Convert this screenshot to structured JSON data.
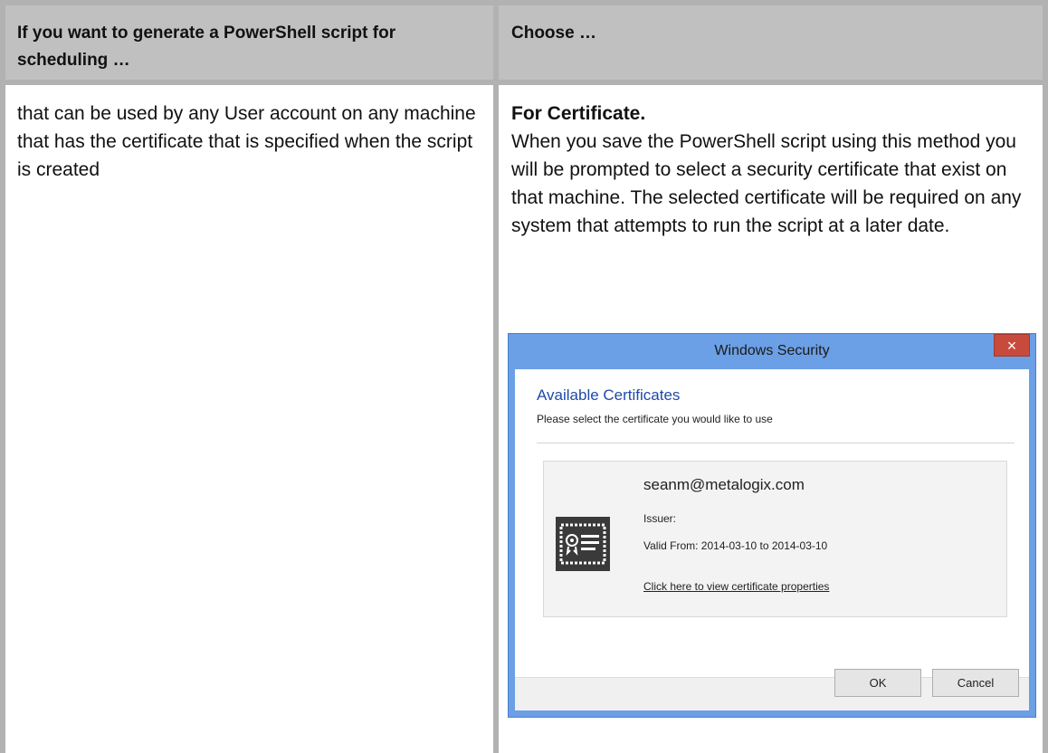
{
  "table": {
    "header": {
      "col1": "If you want to generate a PowerShell script for scheduling …",
      "col2": "Choose …"
    },
    "row": {
      "col1": "that can be used by any User account on any machine that has the certificate that is specified when the script is created",
      "col2_title": "For Certificate.",
      "col2_text": "When you save the PowerShell script using this method you will be prompted to select a security certificate that exist on that machine. The selected certificate will be required on any system that attempts to run the script at a later date."
    }
  },
  "dialog": {
    "title": "Windows Security",
    "close_glyph": "×",
    "heading": "Available Certificates",
    "subtitle": "Please select the certificate you would like to use",
    "certificate": {
      "subject": "seanm@metalogix.com",
      "issuer": "Issuer:",
      "valid": "Valid From: 2014-03-10 to 2014-03-10",
      "link": "Click here to view certificate properties"
    },
    "ok_label": "OK",
    "cancel_label": "Cancel"
  },
  "colors": {
    "header_bg": "#c0c0c0",
    "border": "#b2b2b2",
    "dialog_frame": "#6b9fe6",
    "close_button": "#c74a3c",
    "heading_blue": "#1f4aa8"
  },
  "icons": {
    "certificate": "certificate-icon",
    "close": "close-icon"
  }
}
